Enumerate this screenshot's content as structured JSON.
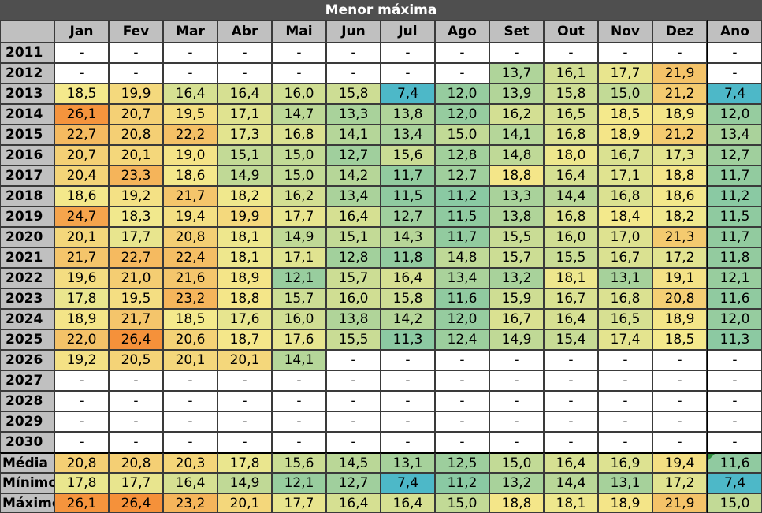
{
  "title": "Menor máxima",
  "months": [
    "Jan",
    "Fev",
    "Mar",
    "Abr",
    "Mai",
    "Jun",
    "Jul",
    "Ago",
    "Set",
    "Out",
    "Nov",
    "Dez"
  ],
  "ano_label": "Ano",
  "rows": [
    {
      "year": "2011",
      "values": [
        "-",
        "-",
        "-",
        "-",
        "-",
        "-",
        "-",
        "-",
        "-",
        "-",
        "-",
        "-"
      ],
      "ano": "-"
    },
    {
      "year": "2012",
      "values": [
        "-",
        "-",
        "-",
        "-",
        "-",
        "-",
        "-",
        "-",
        "13,7",
        "16,1",
        "17,7",
        "21,9"
      ],
      "ano": "-"
    },
    {
      "year": "2013",
      "values": [
        "18,5",
        "19,9",
        "16,4",
        "16,4",
        "16,0",
        "15,8",
        "7,4",
        "12,0",
        "13,9",
        "15,8",
        "15,0",
        "21,2"
      ],
      "ano": "7,4"
    },
    {
      "year": "2014",
      "values": [
        "26,1",
        "20,7",
        "19,5",
        "17,1",
        "14,7",
        "13,3",
        "13,8",
        "12,0",
        "16,2",
        "16,5",
        "18,5",
        "18,9"
      ],
      "ano": "12,0"
    },
    {
      "year": "2015",
      "values": [
        "22,7",
        "20,8",
        "22,2",
        "17,3",
        "16,8",
        "14,1",
        "13,4",
        "15,0",
        "14,1",
        "16,8",
        "18,9",
        "21,2"
      ],
      "ano": "13,4"
    },
    {
      "year": "2016",
      "values": [
        "20,7",
        "20,1",
        "19,0",
        "15,1",
        "15,0",
        "12,7",
        "15,6",
        "12,8",
        "14,8",
        "18,0",
        "16,7",
        "17,3"
      ],
      "ano": "12,7"
    },
    {
      "year": "2017",
      "values": [
        "20,4",
        "23,3",
        "18,6",
        "14,9",
        "15,0",
        "14,2",
        "11,7",
        "12,7",
        "18,8",
        "16,4",
        "17,1",
        "18,8"
      ],
      "ano": "11,7"
    },
    {
      "year": "2018",
      "values": [
        "18,6",
        "19,2",
        "21,7",
        "18,2",
        "16,2",
        "13,4",
        "11,5",
        "11,2",
        "13,3",
        "14,4",
        "16,8",
        "18,6"
      ],
      "ano": "11,2"
    },
    {
      "year": "2019",
      "values": [
        "24,7",
        "18,3",
        "19,4",
        "19,9",
        "17,7",
        "16,4",
        "12,7",
        "11,5",
        "13,8",
        "16,8",
        "18,4",
        "18,2"
      ],
      "ano": "11,5"
    },
    {
      "year": "2020",
      "values": [
        "20,1",
        "17,7",
        "20,8",
        "18,1",
        "14,9",
        "15,1",
        "14,3",
        "11,7",
        "15,5",
        "16,0",
        "17,0",
        "21,3"
      ],
      "ano": "11,7"
    },
    {
      "year": "2021",
      "values": [
        "21,7",
        "22,7",
        "22,4",
        "18,1",
        "17,1",
        "12,8",
        "11,8",
        "14,8",
        "15,7",
        "15,5",
        "16,7",
        "17,2"
      ],
      "ano": "11,8"
    },
    {
      "year": "2022",
      "values": [
        "19,6",
        "21,0",
        "21,6",
        "18,9",
        "12,1",
        "15,7",
        "16,4",
        "13,4",
        "13,2",
        "18,1",
        "13,1",
        "19,1"
      ],
      "ano": "12,1"
    },
    {
      "year": "2023",
      "values": [
        "17,8",
        "19,5",
        "23,2",
        "18,8",
        "15,7",
        "16,0",
        "15,8",
        "11,6",
        "15,9",
        "16,7",
        "16,8",
        "20,8"
      ],
      "ano": "11,6"
    },
    {
      "year": "2024",
      "values": [
        "18,9",
        "21,7",
        "18,5",
        "17,6",
        "16,0",
        "13,8",
        "14,2",
        "12,0",
        "16,7",
        "16,4",
        "16,5",
        "18,9"
      ],
      "ano": "12,0"
    },
    {
      "year": "2025",
      "values": [
        "22,0",
        "26,4",
        "20,6",
        "18,7",
        "17,6",
        "15,5",
        "11,3",
        "12,4",
        "14,9",
        "15,4",
        "17,4",
        "18,5"
      ],
      "ano": "11,3"
    },
    {
      "year": "2026",
      "values": [
        "19,2",
        "20,5",
        "20,1",
        "20,1",
        "14,1",
        "-",
        "-",
        "-",
        "-",
        "-",
        "-",
        "-"
      ],
      "ano": "-"
    },
    {
      "year": "2027",
      "values": [
        "-",
        "-",
        "-",
        "-",
        "-",
        "-",
        "-",
        "-",
        "-",
        "-",
        "-",
        "-"
      ],
      "ano": "-"
    },
    {
      "year": "2028",
      "values": [
        "-",
        "-",
        "-",
        "-",
        "-",
        "-",
        "-",
        "-",
        "-",
        "-",
        "-",
        "-"
      ],
      "ano": "-"
    },
    {
      "year": "2029",
      "values": [
        "-",
        "-",
        "-",
        "-",
        "-",
        "-",
        "-",
        "-",
        "-",
        "-",
        "-",
        "-"
      ],
      "ano": "-"
    },
    {
      "year": "2030",
      "values": [
        "-",
        "-",
        "-",
        "-",
        "-",
        "-",
        "-",
        "-",
        "-",
        "-",
        "-",
        "-"
      ],
      "ano": "-"
    }
  ],
  "summary": [
    {
      "label": "Média",
      "values": [
        "20,8",
        "20,8",
        "20,3",
        "17,8",
        "15,6",
        "14,5",
        "13,1",
        "12,5",
        "15,0",
        "16,4",
        "16,9",
        "19,4"
      ],
      "ano": "11,6"
    },
    {
      "label": "Mínimo",
      "values": [
        "17,8",
        "17,7",
        "16,4",
        "14,9",
        "12,1",
        "12,7",
        "7,4",
        "11,2",
        "13,2",
        "14,4",
        "13,1",
        "17,2"
      ],
      "ano": "7,4"
    },
    {
      "label": "Máximo",
      "values": [
        "26,1",
        "26,4",
        "23,2",
        "20,1",
        "17,7",
        "16,4",
        "16,4",
        "15,0",
        "18,8",
        "18,1",
        "18,9",
        "21,9"
      ],
      "ano": "15,0"
    }
  ],
  "colors": {
    "header_bg": "#c0c0c0",
    "title_bg": "#4f4f4f",
    "scale_low": "#4db8c8",
    "scale_mid_low": "#8fcaa0",
    "scale_mid": "#f4e98c",
    "scale_high": "#f5913a"
  }
}
